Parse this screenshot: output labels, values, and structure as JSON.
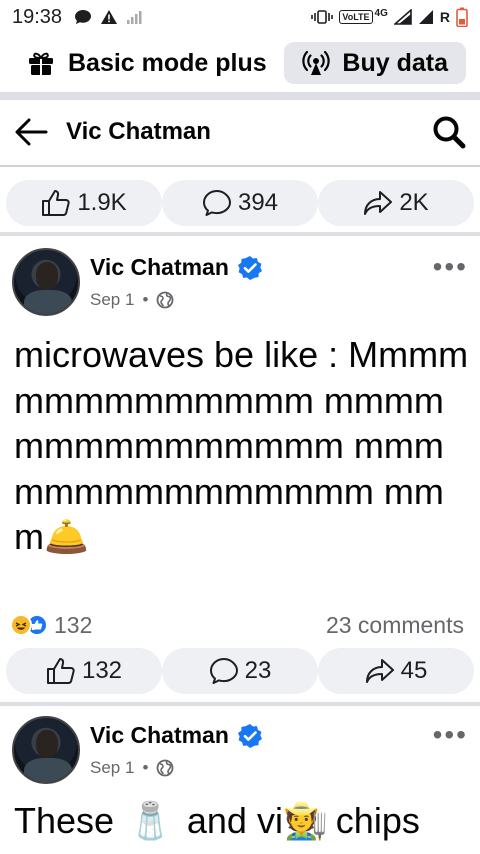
{
  "status_bar": {
    "time": "19:38",
    "volte_label": "VoLTE",
    "network": "4G",
    "roaming": "R"
  },
  "mode_bar": {
    "label": "Basic mode plus",
    "buy_label": "Buy data"
  },
  "header": {
    "title": "Vic Chatman"
  },
  "top_actions": {
    "likes": "1.9K",
    "comments": "394",
    "shares": "2K"
  },
  "post1": {
    "author": "Vic Chatman",
    "date": "Sep 1",
    "dot": "•",
    "text": "microwaves be like : Mmmmmmmmmmmmmm mmmmmmmmmmmmmmm mmmmmmmmmmmmmmm mmm",
    "emoji": "🛎️",
    "reactions_count": "132",
    "comments_summary": "23 comments",
    "likes": "132",
    "comments": "23",
    "shares": "45"
  },
  "post2": {
    "author": "Vic Chatman",
    "date": "Sep 1",
    "dot": "•",
    "text_a": "These",
    "emoji_a": "🧂",
    "text_b": "and vi",
    "emoji_b": "🧑‍🌾",
    "text_c": "chips"
  },
  "colors": {
    "accent": "#1877f2",
    "muted": "#65676b",
    "pill_bg": "#eef0f3",
    "divider": "#dddfe3"
  },
  "icons": [
    "message-icon",
    "warning-icon",
    "signal-icon",
    "gift-icon",
    "broadcast-icon",
    "back-arrow-icon",
    "search-icon",
    "like-icon",
    "comment-icon",
    "share-icon",
    "verified-icon",
    "globe-icon",
    "more-icon",
    "haha-reaction-icon",
    "like-reaction-icon"
  ]
}
